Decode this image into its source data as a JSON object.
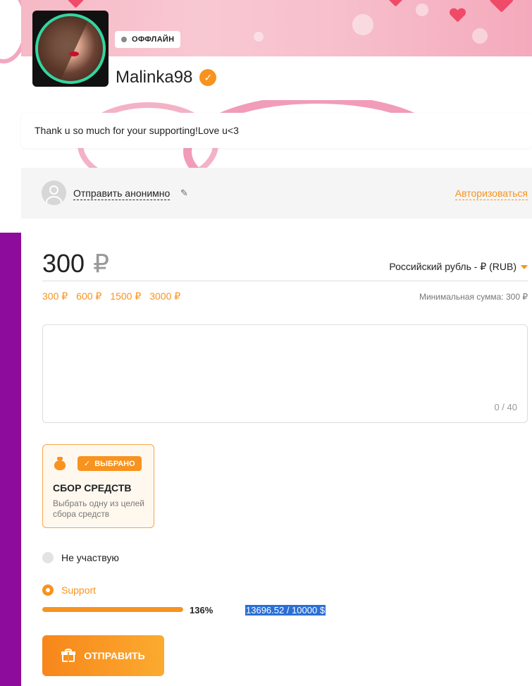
{
  "profile": {
    "status": "ОФФЛАЙН",
    "username": "Malinka98",
    "verified_icon": "verified-check-icon",
    "message": "Thank u so much for your supporting!Love u<3"
  },
  "donate": {
    "anon_label": "Отправить анонимно",
    "auth_label": "Авторизоваться",
    "amount": "300",
    "currency_symbol": "₽",
    "currency_select": "Российский рубль - ₽ (RUB)",
    "presets": [
      "300 ₽",
      "600 ₽",
      "1500 ₽",
      "3000 ₽"
    ],
    "min_sum": "Минимальная сумма: 300 ₽",
    "comment_counter": "0 / 40"
  },
  "goal_card": {
    "badge": "ВЫБРАНО",
    "title": "СБОР СРЕДСТВ",
    "desc": "Выбрать одну из целей сбора средств"
  },
  "goals": {
    "none_label": "Не участвую",
    "goal_label": "Support",
    "progress_fraction": 1.0,
    "progress_percent": "136%",
    "totals": "13696.52 / 10000 $"
  },
  "send_label": "ОТПРАВИТЬ",
  "colors": {
    "accent": "#f7931e",
    "online_ring": "#33d6a0",
    "side_strip": "#8d0c9c"
  }
}
